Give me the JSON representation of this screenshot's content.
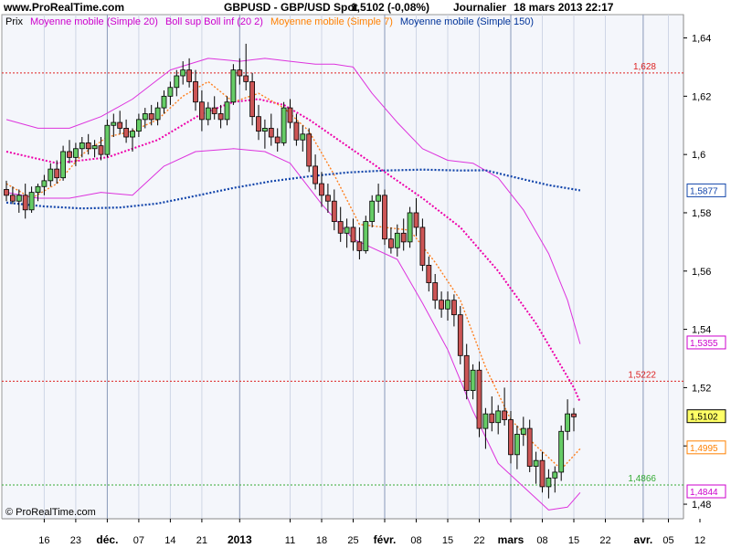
{
  "header": {
    "site": "www.ProRealTime.com",
    "title": "GBPUSD - GBP/USD Spot",
    "last": "1,5102 (-0,08%)",
    "period": "Journalier",
    "datetime": "18 mars 2013 22:17"
  },
  "legend": [
    {
      "text": "Prix",
      "color": "#000000"
    },
    {
      "text": "Moyenne mobile (Simple 20)",
      "color": "#cc00cc"
    },
    {
      "text": "Boll sup Boll inf (20 2)",
      "color": "#cc00cc"
    },
    {
      "text": "Moyenne mobile (Simple 7)",
      "color": "#ff8000"
    },
    {
      "text": "Moyenne mobile (Simple 150)",
      "color": "#003399"
    }
  ],
  "copyright": "© ProRealTime.com",
  "colors": {
    "up": "#66cc66",
    "down": "#cc5555",
    "plotBg": "#f4f6fb",
    "ma20": "#ee00aa",
    "boll": "#dd33dd",
    "ma7": "#ff8020",
    "ma150": "#1144aa",
    "resistance": "#dd2222",
    "support": "#33aa33"
  },
  "chart_data": {
    "type": "candlestick",
    "ylim": [
      1.475,
      1.648
    ],
    "yticks": [
      "1,64",
      "1,62",
      "1,6",
      "1,58",
      "1,56",
      "1,54",
      "1,52",
      "1,5",
      "1,48"
    ],
    "ytick_values": [
      1.64,
      1.62,
      1.6,
      1.58,
      1.56,
      1.54,
      1.52,
      1.5,
      1.48
    ],
    "xticks": [
      {
        "label": "16",
        "bar": 6,
        "bold": false
      },
      {
        "label": "23",
        "bar": 11,
        "bold": false
      },
      {
        "label": "déc.",
        "bar": 16,
        "bold": true
      },
      {
        "label": "07",
        "bar": 21,
        "bold": false
      },
      {
        "label": "14",
        "bar": 26,
        "bold": false
      },
      {
        "label": "21",
        "bar": 31,
        "bold": false
      },
      {
        "label": "2013",
        "bar": 37,
        "bold": true
      },
      {
        "label": "11",
        "bar": 45,
        "bold": false
      },
      {
        "label": "18",
        "bar": 50,
        "bold": false
      },
      {
        "label": "25",
        "bar": 55,
        "bold": false
      },
      {
        "label": "févr.",
        "bar": 60,
        "bold": true
      },
      {
        "label": "08",
        "bar": 65,
        "bold": false
      },
      {
        "label": "15",
        "bar": 70,
        "bold": false
      },
      {
        "label": "22",
        "bar": 75,
        "bold": false
      },
      {
        "label": "mars",
        "bar": 80,
        "bold": true
      },
      {
        "label": "08",
        "bar": 85,
        "bold": false
      },
      {
        "label": "15",
        "bar": 90,
        "bold": false
      },
      {
        "label": "22",
        "bar": 95,
        "bold": false
      },
      {
        "label": "avr.",
        "bar": 101,
        "bold": true
      },
      {
        "label": "05",
        "bar": 105,
        "bold": false
      },
      {
        "label": "12",
        "bar": 110,
        "bold": false
      }
    ],
    "month_lines": [
      16,
      37,
      60,
      80,
      101
    ],
    "levels": [
      {
        "value": 1.628,
        "label": "1,628",
        "kind": "resistance"
      },
      {
        "value": 1.5222,
        "label": "1,5222",
        "kind": "resistance"
      },
      {
        "value": 1.4866,
        "label": "1,4866",
        "kind": "support"
      }
    ],
    "badges": [
      {
        "value": 1.5877,
        "label": "1,5877",
        "color": "#1144aa",
        "bg": "#ffffff"
      },
      {
        "value": 1.5355,
        "label": "1,5355",
        "color": "#cc00cc",
        "bg": "#ffffff"
      },
      {
        "value": 1.5102,
        "label": "1,5102",
        "color": "#000000",
        "bg": "#ffff66"
      },
      {
        "value": 1.4995,
        "label": "1,4995",
        "color": "#ff8000",
        "bg": "#ffffff"
      },
      {
        "value": 1.4844,
        "label": "1,4844",
        "color": "#cc00cc",
        "bg": "#ffffff"
      }
    ],
    "candles": [
      [
        1.588,
        1.591,
        1.584,
        1.586
      ],
      [
        1.586,
        1.589,
        1.583,
        1.584
      ],
      [
        1.584,
        1.588,
        1.58,
        1.586
      ],
      [
        1.586,
        1.59,
        1.578,
        1.581
      ],
      [
        1.581,
        1.589,
        1.58,
        1.587
      ],
      [
        1.587,
        1.59,
        1.584,
        1.589
      ],
      [
        1.589,
        1.593,
        1.586,
        1.591
      ],
      [
        1.591,
        1.597,
        1.589,
        1.595
      ],
      [
        1.595,
        1.598,
        1.59,
        1.592
      ],
      [
        1.592,
        1.603,
        1.591,
        1.601
      ],
      [
        1.601,
        1.605,
        1.597,
        1.599
      ],
      [
        1.599,
        1.604,
        1.596,
        1.602
      ],
      [
        1.602,
        1.606,
        1.599,
        1.604
      ],
      [
        1.604,
        1.607,
        1.6,
        1.602
      ],
      [
        1.602,
        1.605,
        1.599,
        1.603
      ],
      [
        1.603,
        1.606,
        1.598,
        1.6
      ],
      [
        1.6,
        1.612,
        1.599,
        1.61
      ],
      [
        1.61,
        1.614,
        1.606,
        1.611
      ],
      [
        1.611,
        1.615,
        1.607,
        1.609
      ],
      [
        1.609,
        1.612,
        1.604,
        1.606
      ],
      [
        1.606,
        1.609,
        1.601,
        1.608
      ],
      [
        1.608,
        1.614,
        1.606,
        1.612
      ],
      [
        1.612,
        1.616,
        1.609,
        1.614
      ],
      [
        1.614,
        1.617,
        1.61,
        1.612
      ],
      [
        1.612,
        1.618,
        1.61,
        1.616
      ],
      [
        1.616,
        1.622,
        1.614,
        1.62
      ],
      [
        1.62,
        1.625,
        1.617,
        1.623
      ],
      [
        1.623,
        1.629,
        1.62,
        1.627
      ],
      [
        1.627,
        1.632,
        1.624,
        1.629
      ],
      [
        1.629,
        1.633,
        1.623,
        1.625
      ],
      [
        1.625,
        1.629,
        1.615,
        1.618
      ],
      [
        1.618,
        1.622,
        1.608,
        1.612
      ],
      [
        1.612,
        1.618,
        1.61,
        1.616
      ],
      [
        1.616,
        1.62,
        1.612,
        1.614
      ],
      [
        1.614,
        1.617,
        1.609,
        1.612
      ],
      [
        1.612,
        1.62,
        1.61,
        1.618
      ],
      [
        1.618,
        1.631,
        1.617,
        1.629
      ],
      [
        1.629,
        1.633,
        1.624,
        1.627
      ],
      [
        1.627,
        1.638,
        1.622,
        1.625
      ],
      [
        1.625,
        1.628,
        1.61,
        1.613
      ],
      [
        1.613,
        1.617,
        1.605,
        1.608
      ],
      [
        1.608,
        1.612,
        1.602,
        1.609
      ],
      [
        1.609,
        1.614,
        1.603,
        1.606
      ],
      [
        1.606,
        1.609,
        1.601,
        1.604
      ],
      [
        1.604,
        1.618,
        1.603,
        1.616
      ],
      [
        1.616,
        1.619,
        1.609,
        1.611
      ],
      [
        1.611,
        1.614,
        1.603,
        1.605
      ],
      [
        1.605,
        1.61,
        1.601,
        1.607
      ],
      [
        1.607,
        1.609,
        1.594,
        1.596
      ],
      [
        1.596,
        1.6,
        1.588,
        1.59
      ],
      [
        1.59,
        1.594,
        1.582,
        1.586
      ],
      [
        1.586,
        1.59,
        1.58,
        1.584
      ],
      [
        1.584,
        1.588,
        1.574,
        1.577
      ],
      [
        1.577,
        1.582,
        1.57,
        1.573
      ],
      [
        1.573,
        1.578,
        1.568,
        1.575
      ],
      [
        1.575,
        1.578,
        1.567,
        1.57
      ],
      [
        1.57,
        1.575,
        1.564,
        1.567
      ],
      [
        1.567,
        1.579,
        1.566,
        1.577
      ],
      [
        1.577,
        1.586,
        1.575,
        1.584
      ],
      [
        1.584,
        1.59,
        1.58,
        1.586
      ],
      [
        1.586,
        1.588,
        1.569,
        1.571
      ],
      [
        1.571,
        1.575,
        1.566,
        1.568
      ],
      [
        1.568,
        1.576,
        1.565,
        1.573
      ],
      [
        1.573,
        1.578,
        1.567,
        1.57
      ],
      [
        1.57,
        1.582,
        1.568,
        1.58
      ],
      [
        1.58,
        1.585,
        1.572,
        1.575
      ],
      [
        1.575,
        1.578,
        1.56,
        1.562
      ],
      [
        1.562,
        1.565,
        1.553,
        1.556
      ],
      [
        1.556,
        1.559,
        1.547,
        1.55
      ],
      [
        1.55,
        1.553,
        1.544,
        1.547
      ],
      [
        1.547,
        1.553,
        1.543,
        1.55
      ],
      [
        1.55,
        1.552,
        1.541,
        1.545
      ],
      [
        1.545,
        1.548,
        1.528,
        1.531
      ],
      [
        1.531,
        1.535,
        1.516,
        1.519
      ],
      [
        1.519,
        1.528,
        1.516,
        1.526
      ],
      [
        1.526,
        1.529,
        1.503,
        1.506
      ],
      [
        1.506,
        1.513,
        1.499,
        1.511
      ],
      [
        1.511,
        1.517,
        1.505,
        1.508
      ],
      [
        1.508,
        1.514,
        1.504,
        1.512
      ],
      [
        1.512,
        1.52,
        1.507,
        1.509
      ],
      [
        1.509,
        1.512,
        1.494,
        1.497
      ],
      [
        1.497,
        1.507,
        1.492,
        1.504
      ],
      [
        1.504,
        1.51,
        1.5,
        1.506
      ],
      [
        1.506,
        1.509,
        1.491,
        1.493
      ],
      [
        1.493,
        1.498,
        1.487,
        1.495
      ],
      [
        1.495,
        1.498,
        1.484,
        1.486
      ],
      [
        1.486,
        1.492,
        1.482,
        1.489
      ],
      [
        1.489,
        1.493,
        1.484,
        1.491
      ],
      [
        1.491,
        1.507,
        1.488,
        1.505
      ],
      [
        1.505,
        1.516,
        1.502,
        1.511
      ],
      [
        1.511,
        1.513,
        1.505,
        1.51
      ]
    ],
    "ma20": [
      [
        0,
        1.601
      ],
      [
        8,
        1.597
      ],
      [
        16,
        1.599
      ],
      [
        24,
        1.605
      ],
      [
        31,
        1.614
      ],
      [
        36,
        1.618
      ],
      [
        40,
        1.619
      ],
      [
        44,
        1.617
      ],
      [
        48,
        1.612
      ],
      [
        54,
        1.603
      ],
      [
        60,
        1.594
      ],
      [
        66,
        1.585
      ],
      [
        72,
        1.575
      ],
      [
        78,
        1.56
      ],
      [
        84,
        1.542
      ],
      [
        90,
        1.52
      ],
      [
        91,
        1.515
      ]
    ],
    "bollUp": [
      [
        0,
        1.612
      ],
      [
        5,
        1.609
      ],
      [
        10,
        1.609
      ],
      [
        15,
        1.613
      ],
      [
        20,
        1.619
      ],
      [
        26,
        1.629
      ],
      [
        32,
        1.633
      ],
      [
        37,
        1.632
      ],
      [
        41,
        1.633
      ],
      [
        45,
        1.632
      ],
      [
        49,
        1.631
      ],
      [
        52,
        1.631
      ],
      [
        55,
        1.63
      ],
      [
        58,
        1.621
      ],
      [
        62,
        1.611
      ],
      [
        66,
        1.602
      ],
      [
        70,
        1.598
      ],
      [
        74,
        1.597
      ],
      [
        78,
        1.592
      ],
      [
        82,
        1.581
      ],
      [
        86,
        1.566
      ],
      [
        89,
        1.55
      ],
      [
        91,
        1.535
      ]
    ],
    "bollDn": [
      [
        0,
        1.587
      ],
      [
        5,
        1.585
      ],
      [
        10,
        1.585
      ],
      [
        15,
        1.587
      ],
      [
        20,
        1.586
      ],
      [
        25,
        1.596
      ],
      [
        30,
        1.601
      ],
      [
        36,
        1.602
      ],
      [
        41,
        1.601
      ],
      [
        45,
        1.597
      ],
      [
        50,
        1.583
      ],
      [
        55,
        1.571
      ],
      [
        58,
        1.568
      ],
      [
        62,
        1.564
      ],
      [
        66,
        1.549
      ],
      [
        70,
        1.533
      ],
      [
        74,
        1.512
      ],
      [
        78,
        1.494
      ],
      [
        82,
        1.486
      ],
      [
        86,
        1.478
      ],
      [
        89,
        1.479
      ],
      [
        91,
        1.484
      ]
    ],
    "ma7": [
      [
        0,
        1.59
      ],
      [
        4,
        1.585
      ],
      [
        8,
        1.59
      ],
      [
        12,
        1.6
      ],
      [
        16,
        1.606
      ],
      [
        20,
        1.608
      ],
      [
        24,
        1.612
      ],
      [
        28,
        1.62
      ],
      [
        32,
        1.625
      ],
      [
        36,
        1.618
      ],
      [
        40,
        1.621
      ],
      [
        44,
        1.616
      ],
      [
        48,
        1.608
      ],
      [
        52,
        1.593
      ],
      [
        56,
        1.576
      ],
      [
        60,
        1.575
      ],
      [
        64,
        1.574
      ],
      [
        68,
        1.563
      ],
      [
        72,
        1.55
      ],
      [
        76,
        1.527
      ],
      [
        80,
        1.509
      ],
      [
        84,
        1.5
      ],
      [
        88,
        1.492
      ],
      [
        91,
        1.499
      ]
    ],
    "ma150": [
      [
        0,
        1.5835
      ],
      [
        6,
        1.5822
      ],
      [
        12,
        1.5815
      ],
      [
        18,
        1.5818
      ],
      [
        24,
        1.5832
      ],
      [
        30,
        1.5858
      ],
      [
        36,
        1.5885
      ],
      [
        42,
        1.5908
      ],
      [
        48,
        1.5925
      ],
      [
        54,
        1.5938
      ],
      [
        60,
        1.5945
      ],
      [
        66,
        1.5948
      ],
      [
        72,
        1.5945
      ],
      [
        76,
        1.5946
      ],
      [
        80,
        1.5925
      ],
      [
        86,
        1.5895
      ],
      [
        91,
        1.5877
      ]
    ]
  }
}
